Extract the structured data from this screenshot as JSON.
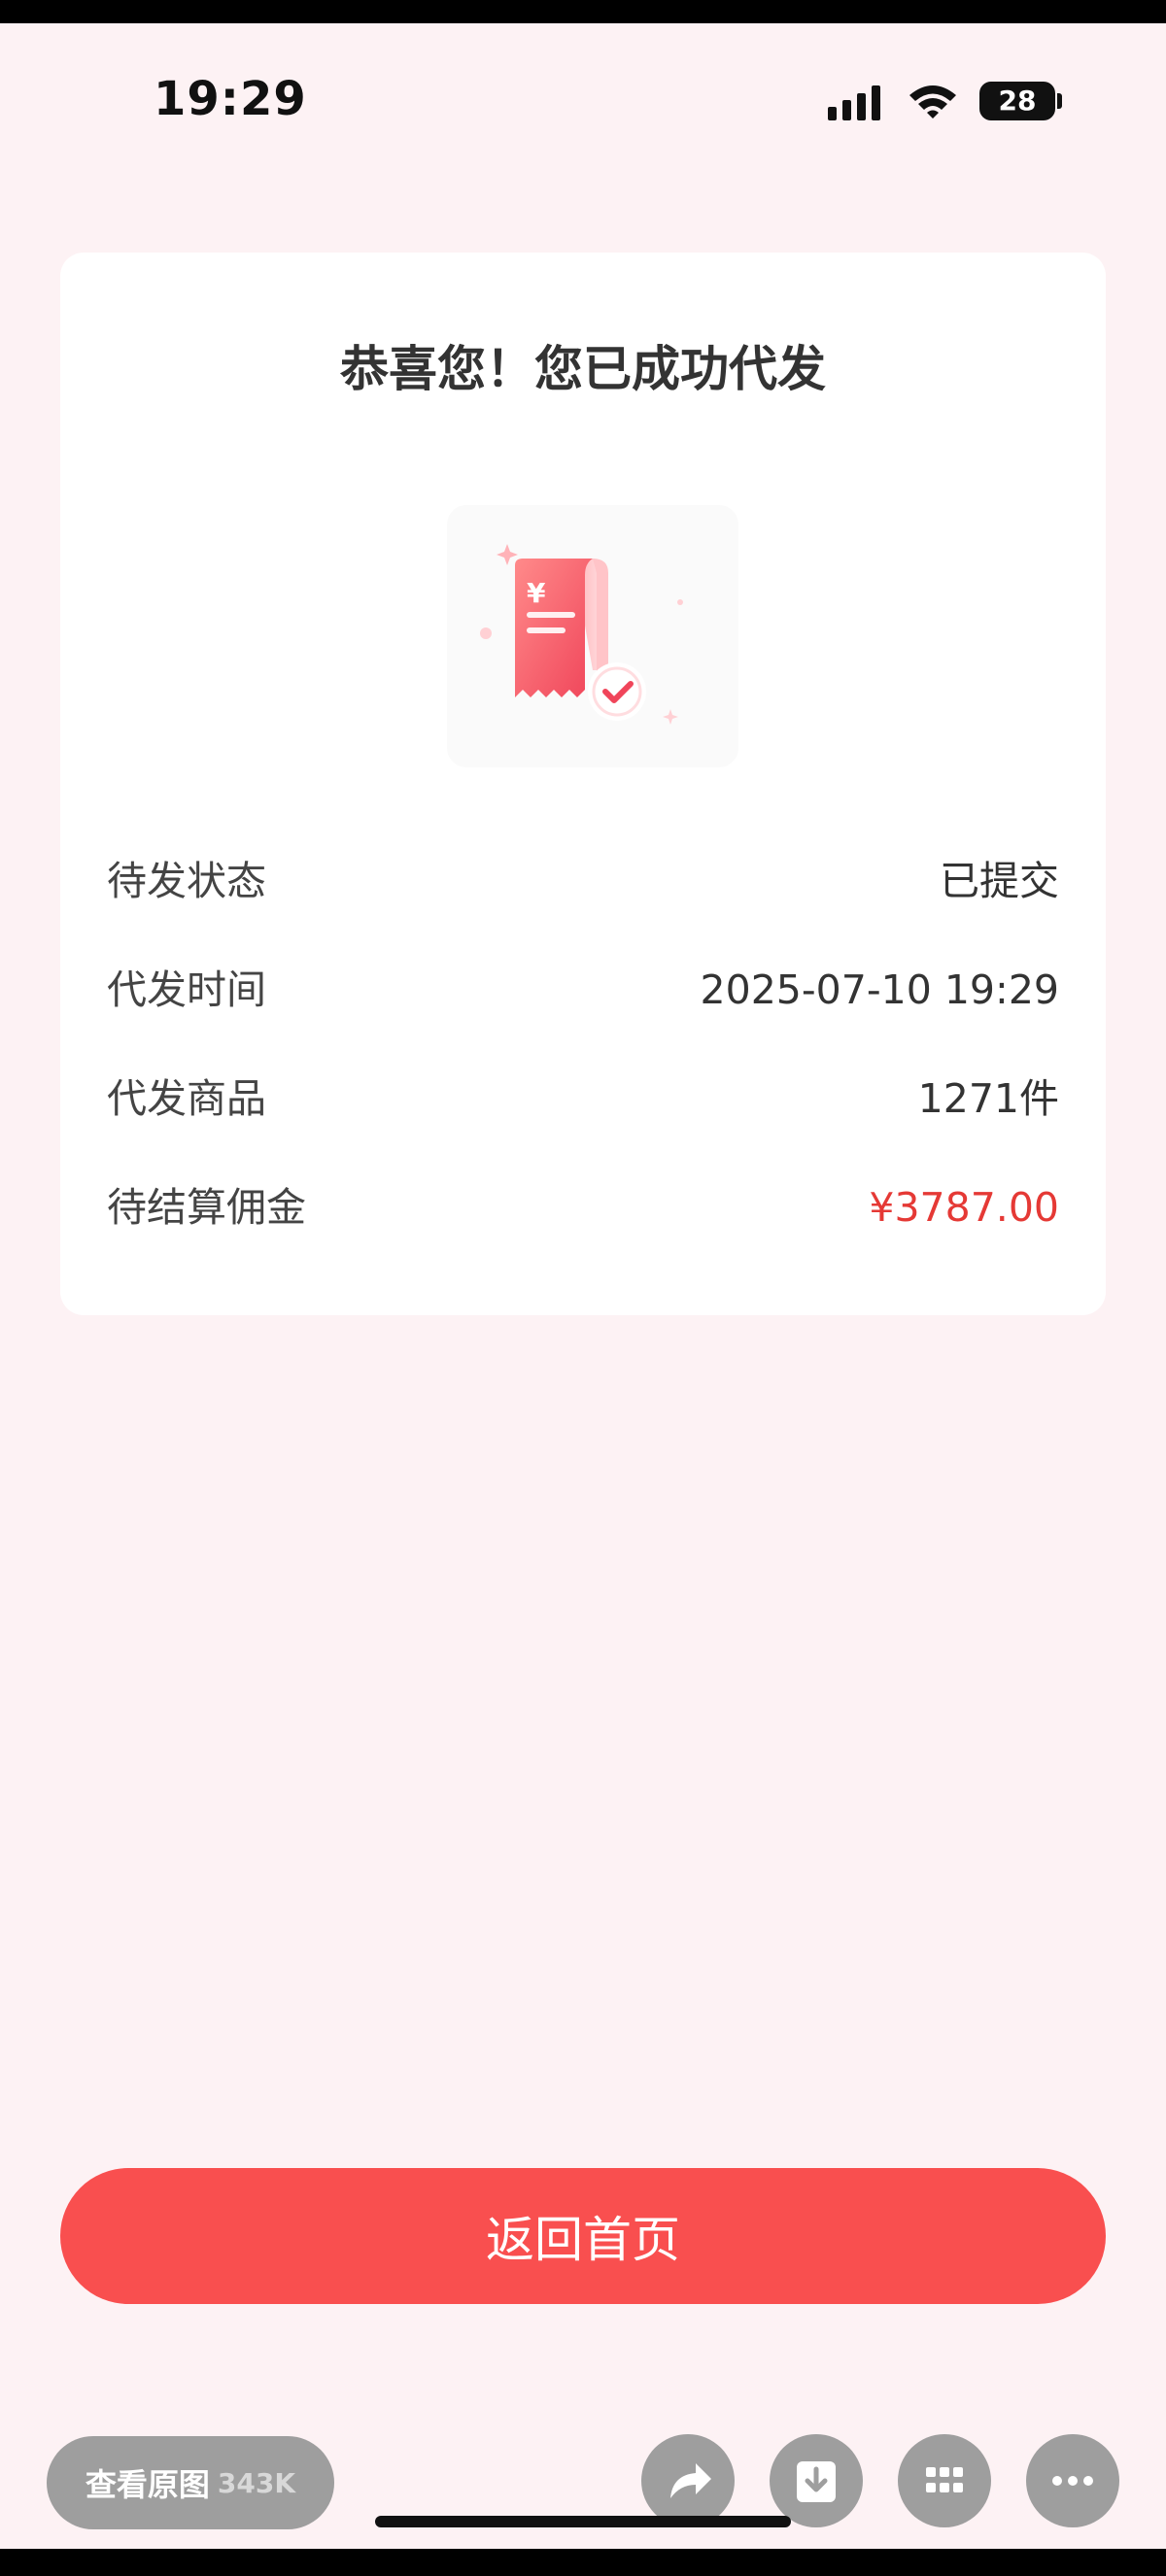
{
  "status_bar": {
    "time": "19:29",
    "battery": "28"
  },
  "card": {
    "title": "恭喜您！您已成功代发",
    "illustration_icon": "receipt-check-icon",
    "rows": [
      {
        "label": "待发状态",
        "value": "已提交"
      },
      {
        "label": "代发时间",
        "value": "2025-07-10 19:29"
      },
      {
        "label": "代发商品",
        "value": "1271件"
      },
      {
        "label": "待结算佣金",
        "value": "¥3787.00"
      }
    ]
  },
  "home_button": {
    "label": "返回首页"
  },
  "viewer": {
    "view_original_label": "查看原图",
    "view_original_size": "343K",
    "icons": [
      "share-icon",
      "download-icon",
      "grid-icon",
      "more-icon"
    ]
  },
  "colors": {
    "accent": "#f94f4f",
    "price": "#e53935",
    "background": "#fdf2f4"
  }
}
